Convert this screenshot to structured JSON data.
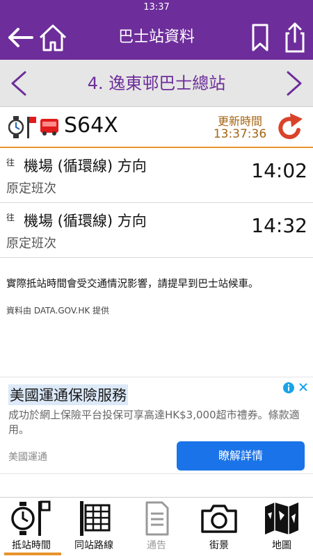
{
  "status_bar": {
    "time": "13:37"
  },
  "header": {
    "title": "巴士站資料"
  },
  "stop": {
    "name": "4. 逸東邨巴士總站"
  },
  "route": {
    "number": "S64X",
    "update_label": "更新時間",
    "update_time": "13:37:36"
  },
  "etas": [
    {
      "to_label": "往",
      "destination": "機場 (循環線) 方向",
      "remark": "原定班次",
      "time": "14:02"
    },
    {
      "to_label": "往",
      "destination": "機場 (循環線) 方向",
      "remark": "原定班次",
      "time": "14:32"
    }
  ],
  "notice": "實際抵站時間會受交通情況影響，請提早到巴士站候車。",
  "source": "資料由 DATA.GOV.HK 提供",
  "ad": {
    "title": "美國運通保險服務",
    "description": "成功於網上保險平台投保可享高達HK$3,000超市禮券。條款適用。",
    "advertiser": "美國運通",
    "button_label": "瞭解詳情"
  },
  "tabs": [
    {
      "label": "抵站時間",
      "icon": "clock-stop-icon",
      "active": true
    },
    {
      "label": "同站路線",
      "icon": "route-list-icon",
      "active": false
    },
    {
      "label": "通告",
      "icon": "notice-icon",
      "active": false,
      "disabled": true
    },
    {
      "label": "街景",
      "icon": "camera-icon",
      "active": false
    },
    {
      "label": "地圖",
      "icon": "map-icon",
      "active": false
    }
  ],
  "colors": {
    "primary": "#6d2d9a",
    "accent": "#e8932b",
    "refresh": "#d9432b",
    "bus_red": "#e11b1b",
    "ad_button": "#1a73e8"
  }
}
